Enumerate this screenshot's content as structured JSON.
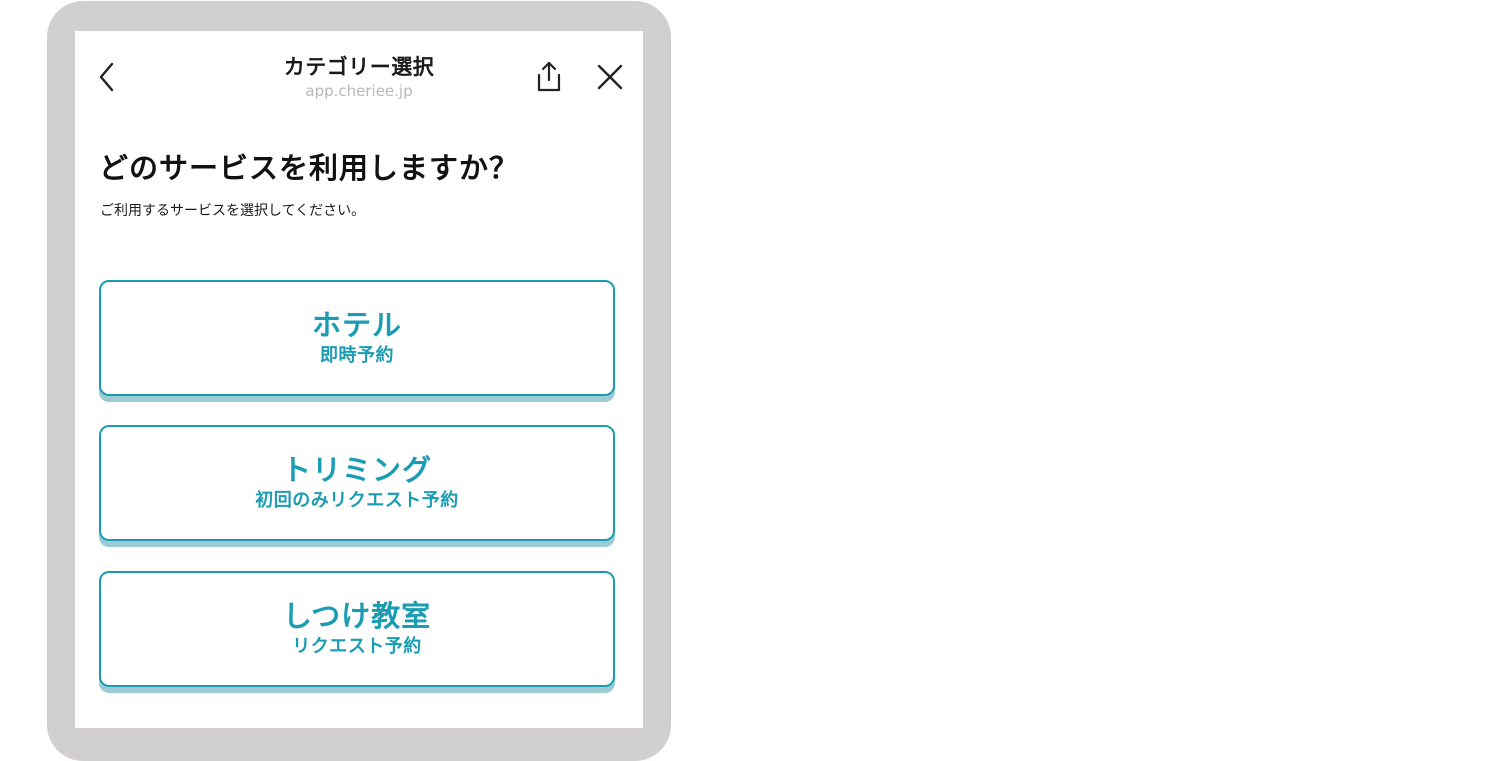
{
  "header": {
    "title": "カテゴリー選択",
    "url": "app.cheriee.jp",
    "back_icon": "chevron-left-icon",
    "share_icon": "share-icon",
    "close_icon": "close-icon"
  },
  "main": {
    "heading": "どのサービスを利用しますか？",
    "subheading": "ご利用するサービスを選択してください。",
    "options": [
      {
        "title": "ホテル",
        "subtitle": "即時予約"
      },
      {
        "title": "トリミング",
        "subtitle": "初回のみリクエスト予約"
      },
      {
        "title": "しつけ教室",
        "subtitle": "リクエスト予約"
      }
    ]
  },
  "colors": {
    "accent": "#1a9cb3",
    "accent_shadow": "#9ccbd6",
    "frame": "#d1cfd0",
    "url_text": "#b8b8b8"
  }
}
